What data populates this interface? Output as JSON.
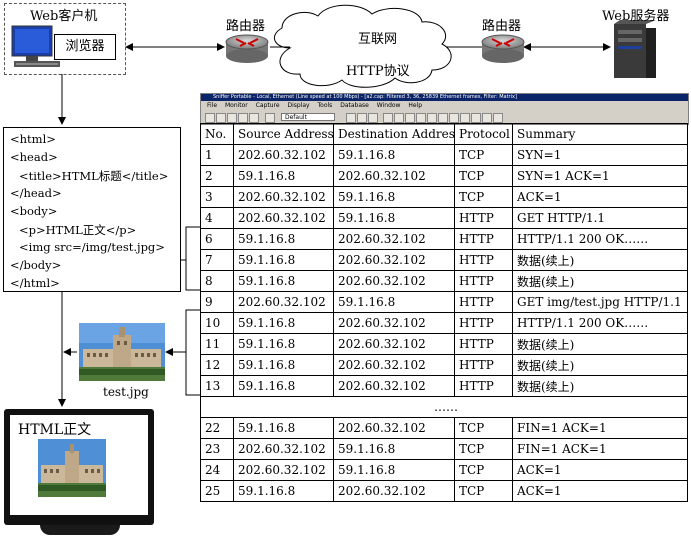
{
  "client": {
    "label": "Web客户机",
    "browser_label": "浏览器"
  },
  "routers": [
    {
      "label": "路由器"
    },
    {
      "label": "路由器"
    }
  ],
  "cloud": {
    "title": "互联网",
    "protocol": "HTTP协议"
  },
  "server": {
    "label": "Web服务器"
  },
  "html_source": {
    "lines": [
      "<html>",
      "<head>",
      "<title>HTML标题</title>",
      "</head>",
      "<body>",
      "<p>HTML正文</p>",
      "<img src=/img/test.jpg>",
      "</body>",
      "</html>"
    ]
  },
  "image_file": {
    "caption": "test.jpg"
  },
  "monitor": {
    "text": "HTML正文"
  },
  "sniffer": {
    "title": "Sniffer Portable - Local, Ethernet (Line speed at 100 Mbps) - [a2.cap: Filtered 3, 36, 25839 Ethernet frames, Filter: Matrix]",
    "menu": [
      "File",
      "Monitor",
      "Capture",
      "Display",
      "Tools",
      "Database",
      "Window",
      "Help"
    ],
    "profile": "Default"
  },
  "packet_table": {
    "headers": [
      "No.",
      "Source Address",
      "Destination Address",
      "Protocol",
      "Summary"
    ],
    "rows": [
      [
        "1",
        "202.60.32.102",
        "59.1.16.8",
        "TCP",
        "SYN=1"
      ],
      [
        "2",
        "59.1.16.8",
        "202.60.32.102",
        "TCP",
        "SYN=1 ACK=1"
      ],
      [
        "3",
        "202.60.32.102",
        "59.1.16.8",
        "TCP",
        "ACK=1"
      ],
      [
        "4",
        "202.60.32.102",
        "59.1.16.8",
        "HTTP",
        "GET HTTP/1.1"
      ],
      [
        "6",
        "59.1.16.8",
        "202.60.32.102",
        "HTTP",
        "HTTP/1.1 200 OK……"
      ],
      [
        "7",
        "59.1.16.8",
        "202.60.32.102",
        "HTTP",
        "数据(续上)"
      ],
      [
        "8",
        "59.1.16.8",
        "202.60.32.102",
        "HTTP",
        "数据(续上)"
      ],
      [
        "9",
        "202.60.32.102",
        "59.1.16.8",
        "HTTP",
        "GET img/test.jpg HTTP/1.1"
      ],
      [
        "10",
        "59.1.16.8",
        "202.60.32.102",
        "HTTP",
        "HTTP/1.1 200 OK……"
      ],
      [
        "11",
        "59.1.16.8",
        "202.60.32.102",
        "HTTP",
        "数据(续上)"
      ],
      [
        "12",
        "59.1.16.8",
        "202.60.32.102",
        "HTTP",
        "数据(续上)"
      ],
      [
        "13",
        "59.1.16.8",
        "202.60.32.102",
        "HTTP",
        "数据(续上)"
      ]
    ],
    "ellipsis": "……",
    "rows_after": [
      [
        "22",
        "59.1.16.8",
        "202.60.32.102",
        "TCP",
        "FIN=1 ACK=1"
      ],
      [
        "23",
        "202.60.32.102",
        "59.1.16.8",
        "TCP",
        "FIN=1 ACK=1"
      ],
      [
        "24",
        "202.60.32.102",
        "59.1.16.8",
        "TCP",
        "ACK=1"
      ],
      [
        "25",
        "59.1.16.8",
        "202.60.32.102",
        "TCP",
        "ACK=1"
      ]
    ]
  }
}
